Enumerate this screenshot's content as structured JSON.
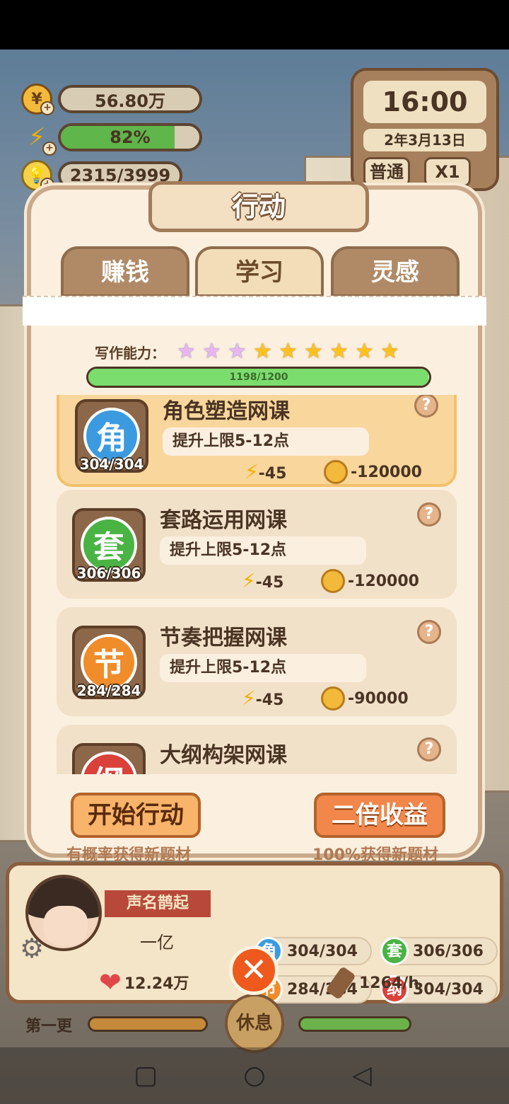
{
  "hud": {
    "money": "56.80万",
    "energy_pct": "82%",
    "energy_fraction": 0.82,
    "inspiration": "2315/3999"
  },
  "clock": {
    "time": "16:00",
    "date": "2年3月13日",
    "mode": "普通",
    "speed": "X1"
  },
  "panel": {
    "title": "行动",
    "tabs": [
      {
        "label": "赚钱",
        "active": false
      },
      {
        "label": "学习",
        "active": true
      },
      {
        "label": "灵感",
        "active": false
      }
    ],
    "ability_label": "写作能力：",
    "stars_total": 9,
    "stars_rainbow": 3,
    "progress_text": "1198/1200",
    "progress_fraction": 0.998
  },
  "courses": [
    {
      "icon_char": "角",
      "color": "#3c9be0",
      "count": "304/304",
      "name": "角色塑造网课",
      "desc": "提升上限5-12点",
      "energy": "-45",
      "cost": "-120000",
      "selected": true
    },
    {
      "icon_char": "套",
      "color": "#49b343",
      "count": "306/306",
      "name": "套路运用网课",
      "desc": "提升上限5-12点",
      "energy": "-45",
      "cost": "-120000",
      "selected": false
    },
    {
      "icon_char": "节",
      "color": "#f08c2a",
      "count": "284/284",
      "name": "节奏把握网课",
      "desc": "提升上限5-12点",
      "energy": "-45",
      "cost": "-90000",
      "selected": false
    },
    {
      "icon_char": "纲",
      "color": "#d9413a",
      "count": "",
      "name": "大纲构架网课",
      "desc": "",
      "energy": "",
      "cost": "",
      "selected": false
    }
  ],
  "actions": {
    "start_label": "开始行动",
    "start_hint": "有概率获得新题材",
    "double_label": "二倍收益",
    "double_hint": "100%获得新题材"
  },
  "profile": {
    "fame_title": "声名鹊起",
    "fame_value": "一亿",
    "likes": "12.24万",
    "rate": "1264/h",
    "skills": [
      {
        "char": "角",
        "color": "#3c9be0",
        "value": "304/304"
      },
      {
        "char": "套",
        "color": "#49b343",
        "value": "306/306"
      },
      {
        "char": "节",
        "color": "#f08c2a",
        "value": "284/284"
      },
      {
        "char": "纲",
        "color": "#d9413a",
        "value": "304/304"
      }
    ],
    "chapter": "第一更",
    "center_badge": "休息"
  }
}
